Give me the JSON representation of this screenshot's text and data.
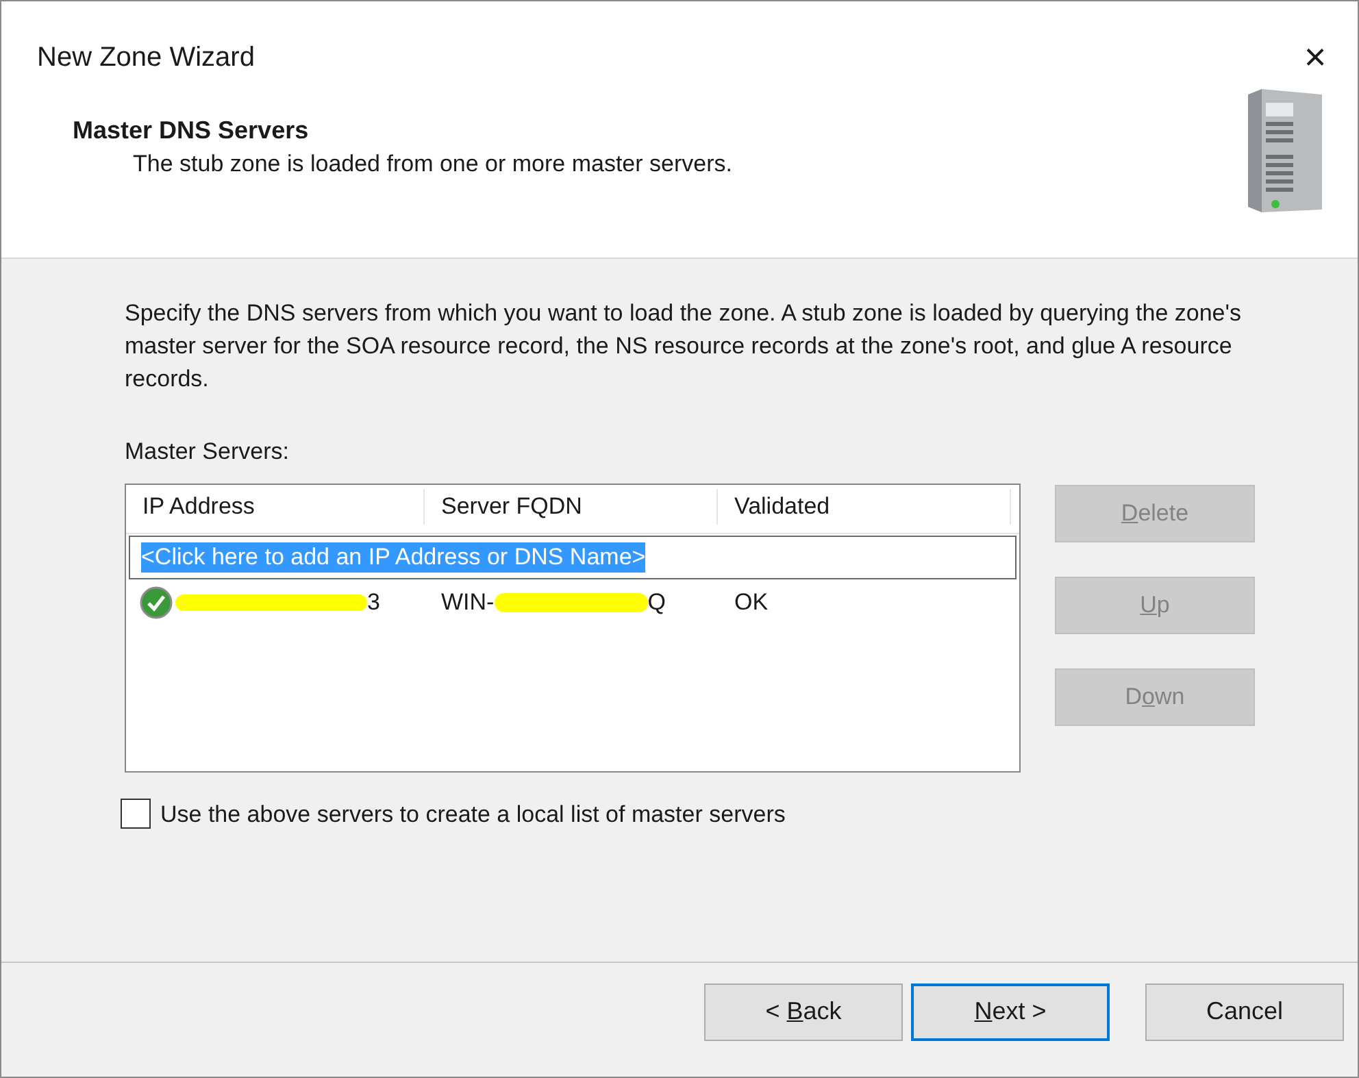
{
  "window": {
    "title": "New Zone Wizard",
    "close": "×"
  },
  "header": {
    "title": "Master DNS Servers",
    "subtitle": "The stub zone is loaded from one or more master servers."
  },
  "description": "Specify the DNS servers from which you want to load the zone. A stub zone is loaded by querying the zone's master server for the SOA resource record, the NS resource records at the zone's root, and glue A resource records.",
  "list_label": "Master Servers:",
  "table": {
    "columns": [
      "IP Address",
      "Server FQDN",
      "Validated"
    ],
    "add_row": {
      "text": "<Click here to add an IP Address or DNS Name>",
      "selected": true
    },
    "rows": [
      {
        "valid": true,
        "ip_address": "3",
        "fqdn_prefix": "WIN-",
        "fqdn_suffix": "Q",
        "validated": "OK"
      }
    ]
  },
  "side_buttons": [
    {
      "accel": "D",
      "rest": "elete",
      "disabled": true
    },
    {
      "accel": "U",
      "rest": "p",
      "disabled": true
    },
    {
      "lead": "D",
      "accel": "o",
      "rest": "wn",
      "disabled": true
    }
  ],
  "checkbox": {
    "label": "Use the above servers to create a local list of master servers",
    "checked": false
  },
  "buttons": [
    {
      "lead": "< ",
      "accel": "B",
      "rest": "ack",
      "default": false
    },
    {
      "accel": "N",
      "rest": "ext >",
      "default": true
    },
    {
      "rest": "Cancel",
      "default": false
    }
  ]
}
